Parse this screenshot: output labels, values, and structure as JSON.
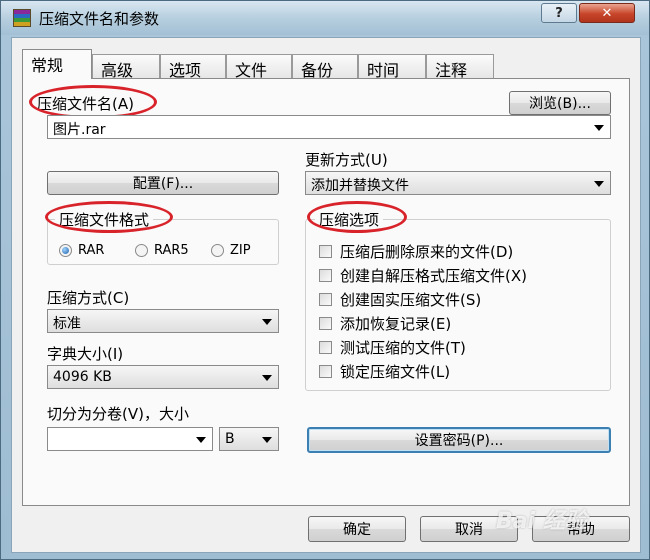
{
  "window": {
    "title": "压缩文件名和参数",
    "help_label": "?",
    "close_label": "✕"
  },
  "tabs": [
    {
      "label": "常规"
    },
    {
      "label": "高级"
    },
    {
      "label": "选项"
    },
    {
      "label": "文件"
    },
    {
      "label": "备份"
    },
    {
      "label": "时间"
    },
    {
      "label": "注释"
    }
  ],
  "archive_name": {
    "label": "压缩文件名(A)",
    "value": "图片.rar",
    "browse_label": "浏览(B)..."
  },
  "update_mode": {
    "label": "更新方式(U)",
    "value": "添加并替换文件"
  },
  "profiles_label": "配置(F)...",
  "format": {
    "label": "压缩文件格式",
    "options": [
      {
        "label": "RAR",
        "checked": true
      },
      {
        "label": "RAR5",
        "checked": false
      },
      {
        "label": "ZIP",
        "checked": false
      }
    ]
  },
  "compression_method": {
    "label": "压缩方式(C)",
    "value": "标准"
  },
  "dictionary_size": {
    "label": "字典大小(I)",
    "value": "4096 KB"
  },
  "split_volumes": {
    "label": "切分为分卷(V)，大小",
    "value": "",
    "unit": "B"
  },
  "options": {
    "label": "压缩选项",
    "items": [
      {
        "label": "压缩后删除原来的文件(D)",
        "checked": false
      },
      {
        "label": "创建自解压格式压缩文件(X)",
        "checked": false
      },
      {
        "label": "创建固实压缩文件(S)",
        "checked": false
      },
      {
        "label": "添加恢复记录(E)",
        "checked": false
      },
      {
        "label": "测试压缩的文件(T)",
        "checked": false
      },
      {
        "label": "锁定压缩文件(L)",
        "checked": false
      }
    ]
  },
  "set_password_label": "设置密码(P)...",
  "footer": {
    "ok_label": "确定",
    "cancel_label": "取消",
    "help_label": "帮助"
  },
  "watermark": "Bai 经验",
  "colors": {
    "highlight_ellipse": "#d8232a",
    "focus_border": "#3c7fb1"
  }
}
